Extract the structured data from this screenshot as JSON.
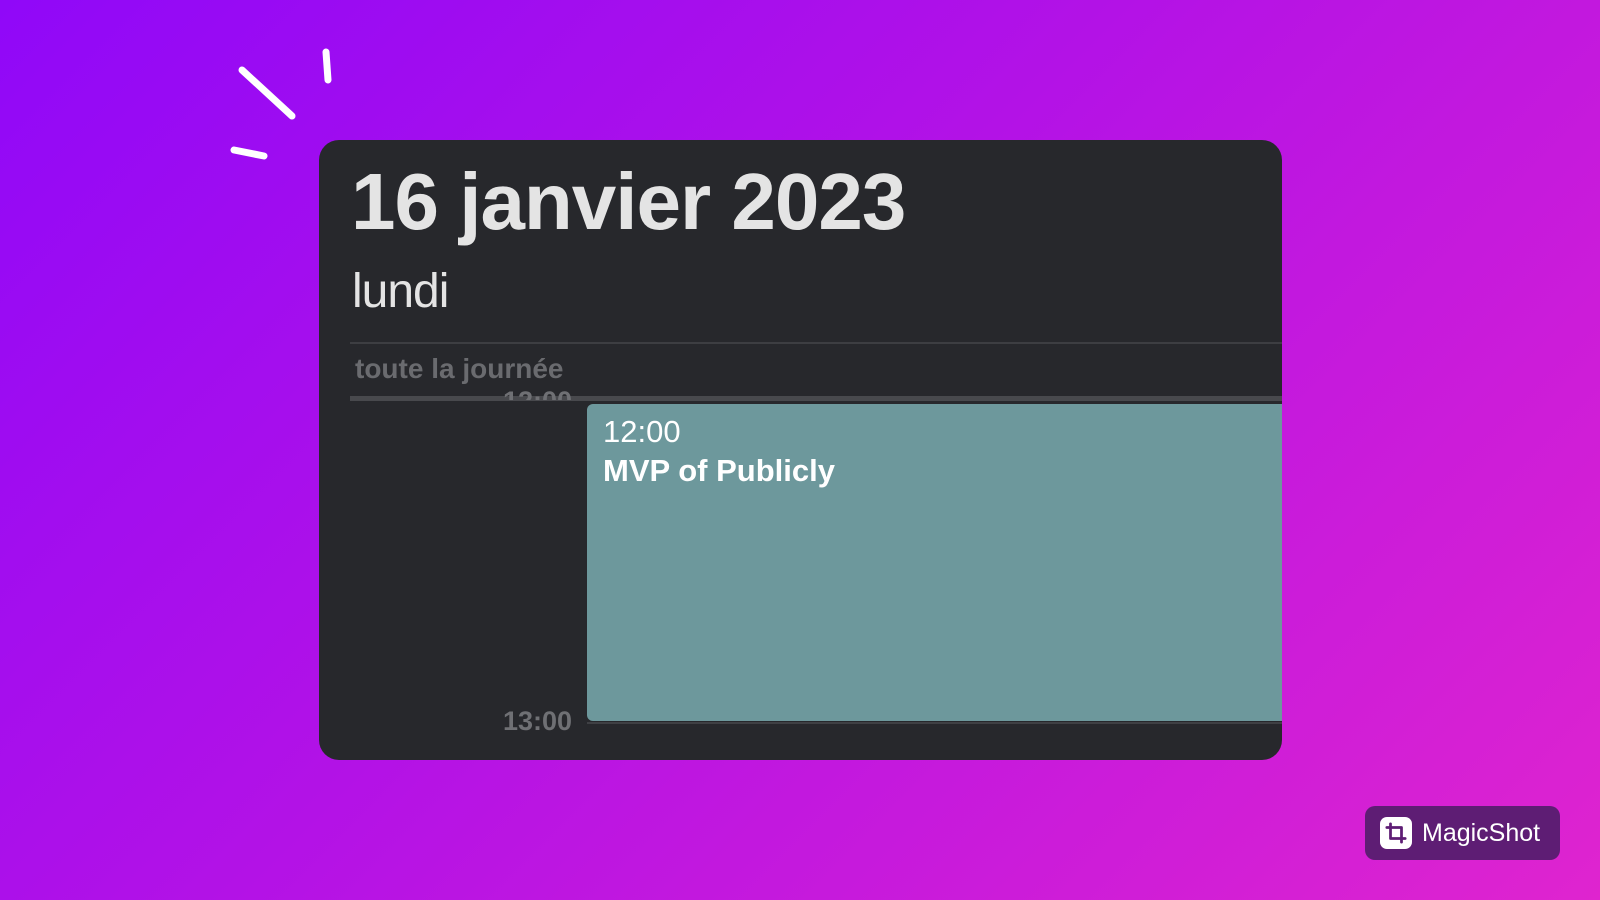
{
  "header": {
    "date_title": "16 janvier 2023",
    "weekday": "lundi"
  },
  "all_day": {
    "label": "toute la journée"
  },
  "timeline": {
    "hours": [
      "12:00",
      "13:00"
    ]
  },
  "event": {
    "time": "12:00",
    "title": "MVP of Publicly",
    "color": "#6d989c"
  },
  "branding": {
    "name": "MagicShot",
    "icon": "crop-icon"
  },
  "colors": {
    "card_background": "#27282c",
    "gradient_start": "#9008f8",
    "gradient_end": "#df24cf"
  }
}
